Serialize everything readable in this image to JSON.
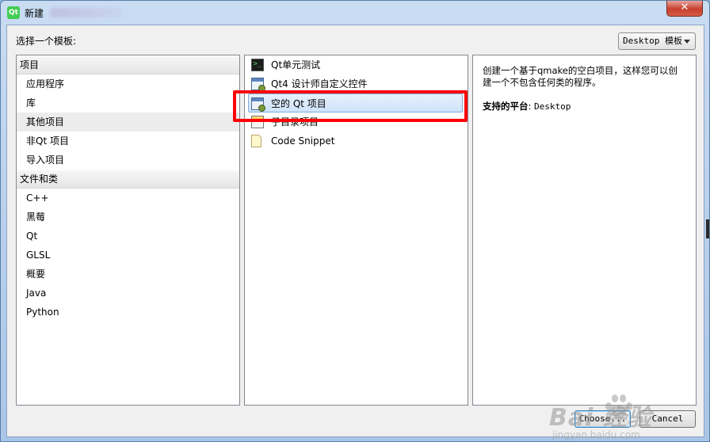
{
  "window": {
    "title": "新建",
    "app_icon": "Qt",
    "close_label": "✕"
  },
  "prompt": "选择一个模板:",
  "filter": {
    "selected": "Desktop 模板"
  },
  "categories": [
    {
      "header": "项目",
      "items": [
        "应用程序",
        "库",
        "其他项目",
        "非Qt 项目",
        "导入项目"
      ],
      "selected": "其他项目"
    },
    {
      "header": "文件和类",
      "items": [
        "C++",
        "黑莓",
        "Qt",
        "GLSL",
        "概要",
        "Java",
        "Python"
      ]
    }
  ],
  "templates": [
    {
      "label": "Qt单元测试",
      "icon": "terminal-icon"
    },
    {
      "label": "Qt4 设计师自定义控件",
      "icon": "window-plugin-icon"
    },
    {
      "label": "空的 Qt 项目",
      "icon": "window-icon",
      "selected": true
    },
    {
      "label": "子目录项目",
      "icon": "subdirs-icon"
    },
    {
      "label": "Code Snippet",
      "icon": "file-icon"
    }
  ],
  "description": {
    "text": "创建一个基于qmake的空白项目，这样您可以创建一个不包含任何类的程序。",
    "platform_label": "支持的平台",
    "platform_value": "Desktop"
  },
  "buttons": {
    "choose": "Choose...",
    "cancel": "Cancel"
  },
  "watermark": {
    "brand": "Bai  经验",
    "sub": "jingyan.baidu.com"
  },
  "colors": {
    "highlight": "#ff0000",
    "selection": "#cfe3fa",
    "close": "#c7402e"
  }
}
